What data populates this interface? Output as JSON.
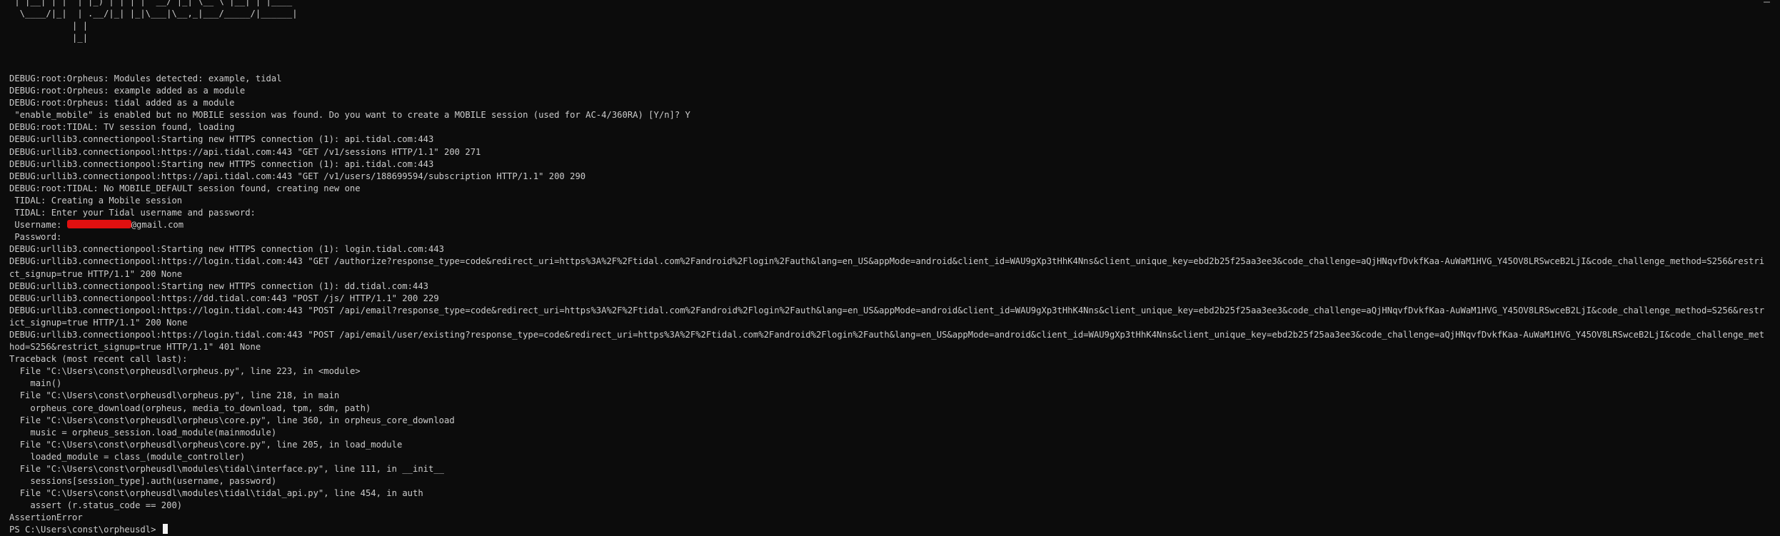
{
  "banner": " | |__| | |  | |_) | | | |  __/ |_| \\__ \\ |__| | |____\n  \\____/|_|  | .__/|_| |_|\\___|\\__,_|___/_____/|______|\n            | |\n            |_|",
  "log": [
    "DEBUG:root:Orpheus: Modules detected: example, tidal",
    "DEBUG:root:Orpheus: example added as a module",
    "DEBUG:root:Orpheus: tidal added as a module",
    " \"enable_mobile\" is enabled but no MOBILE session was found. Do you want to create a MOBILE session (used for AC-4/360RA) [Y/n]? Y",
    "DEBUG:root:TIDAL: TV session found, loading",
    "DEBUG:urllib3.connectionpool:Starting new HTTPS connection (1): api.tidal.com:443",
    "DEBUG:urllib3.connectionpool:https://api.tidal.com:443 \"GET /v1/sessions HTTP/1.1\" 200 271",
    "DEBUG:urllib3.connectionpool:Starting new HTTPS connection (1): api.tidal.com:443",
    "DEBUG:urllib3.connectionpool:https://api.tidal.com:443 \"GET /v1/users/188699594/subscription HTTP/1.1\" 200 290",
    "DEBUG:root:TIDAL: No MOBILE_DEFAULT session found, creating new one",
    " TIDAL: Creating a Mobile session",
    " TIDAL: Enter your Tidal username and password:"
  ],
  "username_prompt": " Username: ",
  "username_suffix": "@gmail.com",
  "log2": [
    " Password:",
    "DEBUG:urllib3.connectionpool:Starting new HTTPS connection (1): login.tidal.com:443",
    "DEBUG:urllib3.connectionpool:https://login.tidal.com:443 \"GET /authorize?response_type=code&redirect_uri=https%3A%2F%2Ftidal.com%2Fandroid%2Flogin%2Fauth&lang=en_US&appMode=android&client_id=WAU9gXp3tHhK4Nns&client_unique_key=ebd2b25f25aa3ee3&code_challenge=aQjHNqvfDvkfKaa-AuWaM1HVG_Y45OV8LRSwceB2LjI&code_challenge_method=S256&restrict_signup=true HTTP/1.1\" 200 None",
    "DEBUG:urllib3.connectionpool:Starting new HTTPS connection (1): dd.tidal.com:443",
    "DEBUG:urllib3.connectionpool:https://dd.tidal.com:443 \"POST /js/ HTTP/1.1\" 200 229",
    "DEBUG:urllib3.connectionpool:https://login.tidal.com:443 \"POST /api/email?response_type=code&redirect_uri=https%3A%2F%2Ftidal.com%2Fandroid%2Flogin%2Fauth&lang=en_US&appMode=android&client_id=WAU9gXp3tHhK4Nns&client_unique_key=ebd2b25f25aa3ee3&code_challenge=aQjHNqvfDvkfKaa-AuWaM1HVG_Y45OV8LRSwceB2LjI&code_challenge_method=S256&restrict_signup=true HTTP/1.1\" 200 None",
    "DEBUG:urllib3.connectionpool:https://login.tidal.com:443 \"POST /api/email/user/existing?response_type=code&redirect_uri=https%3A%2F%2Ftidal.com%2Fandroid%2Flogin%2Fauth&lang=en_US&appMode=android&client_id=WAU9gXp3tHhK4Nns&client_unique_key=ebd2b25f25aa3ee3&code_challenge=aQjHNqvfDvkfKaa-AuWaM1HVG_Y45OV8LRSwceB2LjI&code_challenge_method=S256&restrict_signup=true HTTP/1.1\" 401 None",
    "Traceback (most recent call last):",
    "  File \"C:\\Users\\const\\orpheusdl\\orpheus.py\", line 223, in <module>",
    "    main()",
    "  File \"C:\\Users\\const\\orpheusdl\\orpheus.py\", line 218, in main",
    "    orpheus_core_download(orpheus, media_to_download, tpm, sdm, path)",
    "  File \"C:\\Users\\const\\orpheusdl\\orpheus\\core.py\", line 360, in orpheus_core_download",
    "    music = orpheus_session.load_module(mainmodule)",
    "  File \"C:\\Users\\const\\orpheusdl\\orpheus\\core.py\", line 205, in load_module",
    "    loaded_module = class_(module_controller)",
    "  File \"C:\\Users\\const\\orpheusdl\\modules\\tidal\\interface.py\", line 111, in __init__",
    "    sessions[session_type].auth(username, password)",
    "  File \"C:\\Users\\const\\orpheusdl\\modules\\tidal\\tidal_api.py\", line 454, in auth",
    "    assert (r.status_code == 200)",
    "AssertionError"
  ],
  "prompt": "PS C:\\Users\\const\\orpheusdl> "
}
